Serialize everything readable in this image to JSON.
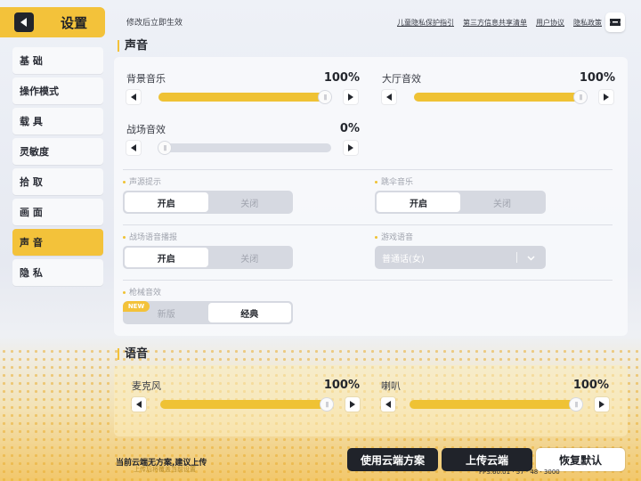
{
  "sidebar": {
    "title": "设置",
    "items": [
      {
        "label": "基 础",
        "active": false
      },
      {
        "label": "操作模式",
        "active": false
      },
      {
        "label": "载 具",
        "active": false
      },
      {
        "label": "灵敏度",
        "active": false
      },
      {
        "label": "拾 取",
        "active": false
      },
      {
        "label": "画 面",
        "active": false
      },
      {
        "label": "声 音",
        "active": true
      },
      {
        "label": "隐 私",
        "active": false
      }
    ]
  },
  "topbar": {
    "notice": "修改后立即生效",
    "links": [
      "儿童隐私保护指引",
      "第三方信息共享清单",
      "用户协议",
      "隐私政策"
    ]
  },
  "sound": {
    "heading": "声音",
    "background_music": {
      "label": "背景音乐",
      "value": "100%",
      "level": 1.0
    },
    "lobby_sfx": {
      "label": "大厅音效",
      "value": "100%",
      "level": 1.0
    },
    "battle_sfx": {
      "label": "战场音效",
      "value": "0%",
      "level": 0.0
    },
    "sound_hint": {
      "label": "声源提示",
      "on": "开启",
      "off": "关闭",
      "selected": "on"
    },
    "parachute_music": {
      "label": "跳伞音乐",
      "on": "开启",
      "off": "关闭",
      "selected": "on"
    },
    "battle_voice": {
      "label": "战场语音播报",
      "on": "开启",
      "off": "关闭",
      "selected": "on"
    },
    "game_voice": {
      "label": "游戏语音",
      "value": "普通话(女)"
    },
    "gun_sfx": {
      "label": "枪械音效",
      "new_badge": "NEW",
      "opt_new": "新版",
      "opt_classic": "经典",
      "selected": "classic"
    }
  },
  "voice": {
    "heading": "语音",
    "microphone": {
      "label": "麦克风",
      "value": "100%",
      "level": 1.0
    },
    "speaker": {
      "label": "喇叭",
      "value": "100%",
      "level": 1.0
    }
  },
  "bottombar": {
    "cloud_status": "当前云端无方案,建议上传",
    "cloud_sub": "上传后将覆盖当前设置",
    "use_cloud": "使用云端方案",
    "upload_cloud": "上传云端",
    "restore_default": "恢复默认",
    "fps": "FPS:60.01 · 57 · 48 · 3000"
  },
  "colors": {
    "accent": "#f3c23a",
    "dark": "#20232a"
  }
}
